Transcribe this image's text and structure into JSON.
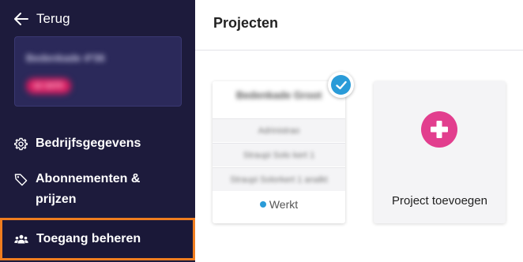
{
  "sidebar": {
    "back_label": "Terug",
    "company": {
      "name": "Bedenkade 4*36",
      "badge": "Id 3470"
    },
    "items": [
      {
        "label": "Bedrijfsgegevens",
        "icon": "gear-icon"
      },
      {
        "label": "Abonnementen &",
        "label2": "prijzen",
        "icon": "tag-icon"
      },
      {
        "label": "Toegang beheren",
        "icon": "users-icon",
        "active": true
      }
    ]
  },
  "main": {
    "title": "Projecten",
    "project_card": {
      "title": "Bedenkade Groot",
      "rows": [
        "Adrinistrao",
        "Straupi Solo kert 1",
        "Straupi Solorkert 1 analkt"
      ],
      "status": "Werkt",
      "status_color": "#2a9bd8",
      "selected": true
    },
    "add_card": {
      "label": "Project toevoegen",
      "accent": "#e23e8e"
    }
  },
  "colors": {
    "sidebar_bg": "#1d1b3c",
    "highlight": "#ef7d1f",
    "check": "#2a9bd8"
  }
}
